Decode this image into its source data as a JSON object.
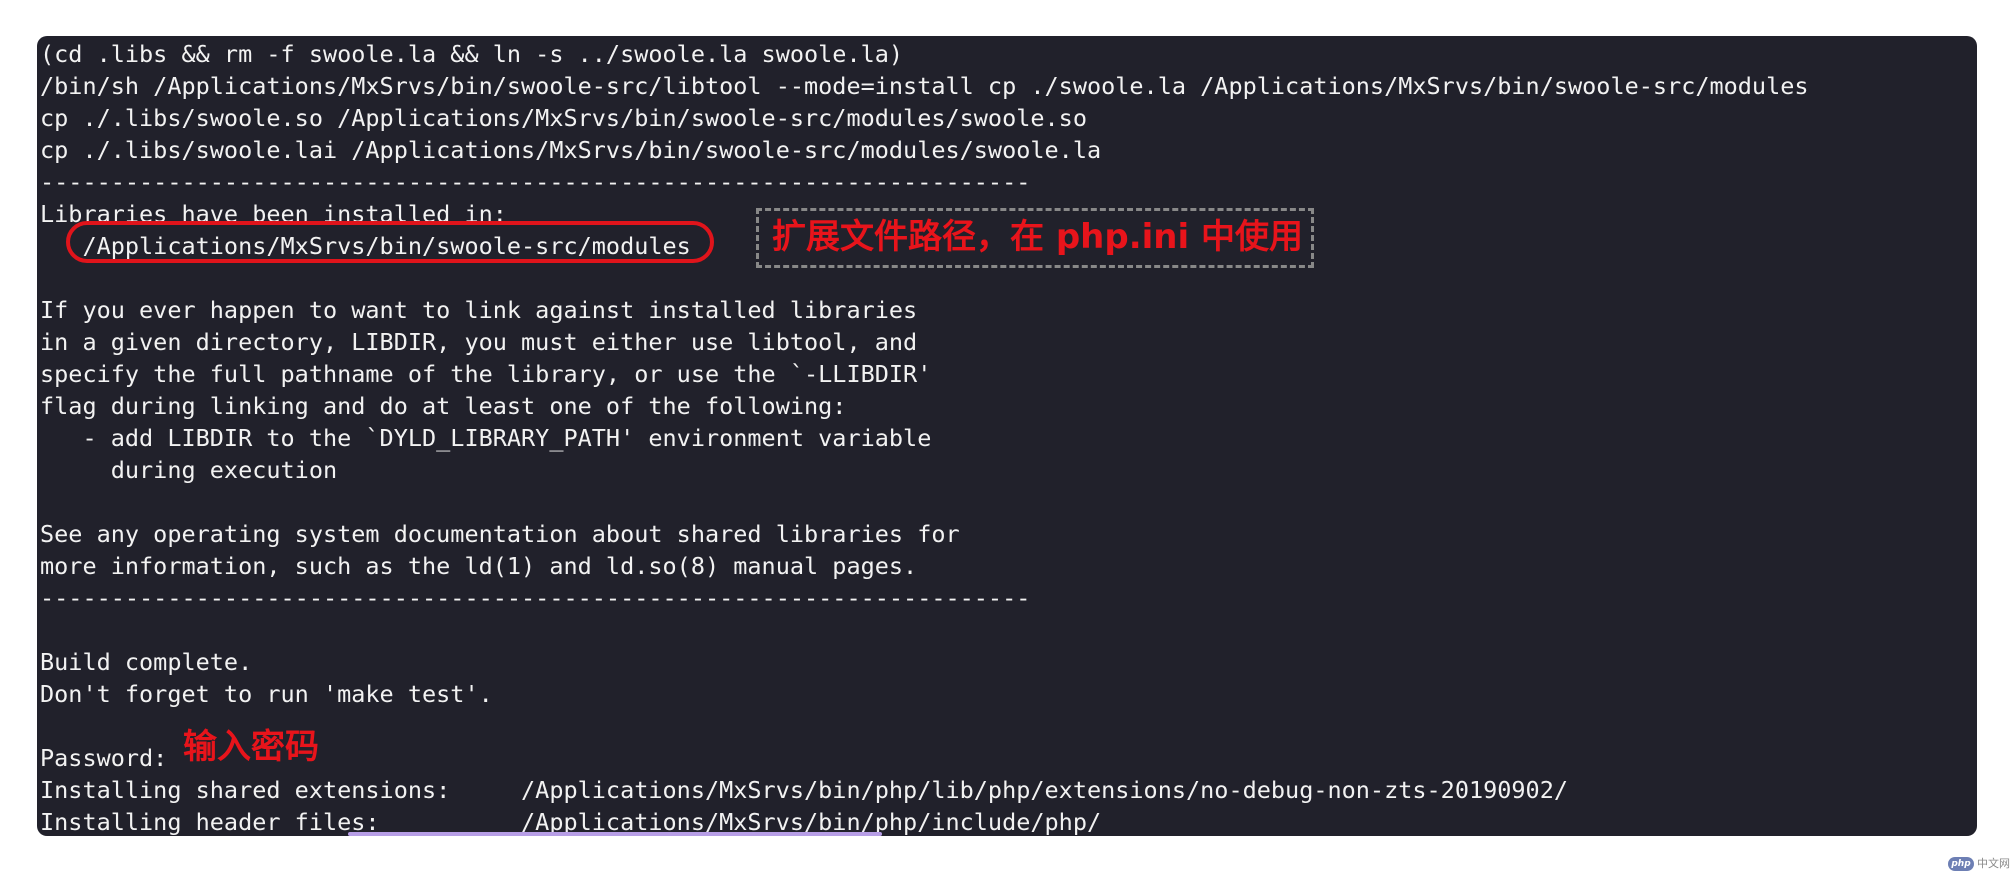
{
  "terminal": {
    "lines": [
      "(cd .libs && rm -f swoole.la && ln -s ../swoole.la swoole.la)",
      "/bin/sh /Applications/MxSrvs/bin/swoole-src/libtool --mode=install cp ./swoole.la /Applications/MxSrvs/bin/swoole-src/modules",
      "cp ./.libs/swoole.so /Applications/MxSrvs/bin/swoole-src/modules/swoole.so",
      "cp ./.libs/swoole.lai /Applications/MxSrvs/bin/swoole-src/modules/swoole.la",
      "----------------------------------------------------------------------",
      "Libraries have been installed in:",
      "   /Applications/MxSrvs/bin/swoole-src/modules",
      "",
      "If you ever happen to want to link against installed libraries",
      "in a given directory, LIBDIR, you must either use libtool, and",
      "specify the full pathname of the library, or use the `-LLIBDIR'",
      "flag during linking and do at least one of the following:",
      "   - add LIBDIR to the `DYLD_LIBRARY_PATH' environment variable",
      "     during execution",
      "",
      "See any operating system documentation about shared libraries for",
      "more information, such as the ld(1) and ld.so(8) manual pages.",
      "----------------------------------------------------------------------",
      "",
      "Build complete.",
      "Don't forget to run 'make test'.",
      "",
      "Password:",
      "Installing shared extensions:     /Applications/MxSrvs/bin/php/lib/php/extensions/no-debug-non-zts-20190902/",
      "Installing header files:          /Applications/MxSrvs/bin/php/include/php/"
    ]
  },
  "annotations": {
    "path_note": "扩展文件路径，在 php.ini 中使用",
    "password_note": "输入密码"
  },
  "watermark": {
    "logo": "php",
    "text": "中文网"
  },
  "colors": {
    "terminal_bg": "#21212b",
    "terminal_fg": "#f2f2f2",
    "annotation_red": "#e8141b",
    "dashed_border": "#888888",
    "scroll_indicator": "#b79ee6"
  }
}
